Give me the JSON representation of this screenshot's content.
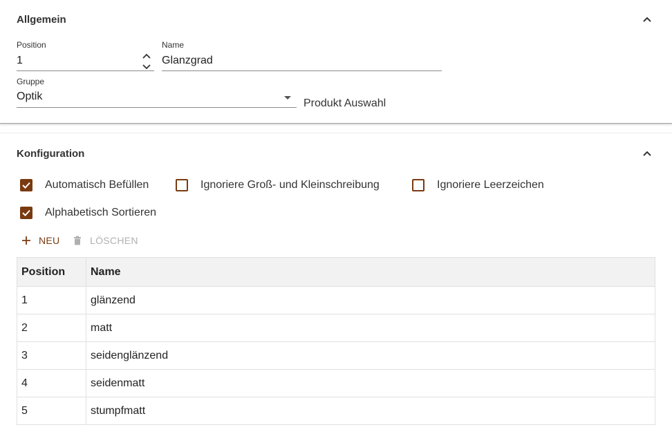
{
  "allgemein": {
    "title": "Allgemein",
    "position_label": "Position",
    "position_value": "1",
    "name_label": "Name",
    "name_value": "Glanzgrad",
    "gruppe_label": "Gruppe",
    "gruppe_value": "Optik",
    "product_label": "Produkt Auswahl"
  },
  "konfiguration": {
    "title": "Konfiguration",
    "checkboxes": [
      {
        "label": "Automatisch Befüllen",
        "checked": true
      },
      {
        "label": "Ignoriere Groß- und Kleinschreibung",
        "checked": false
      },
      {
        "label": "Ignoriere Leerzeichen",
        "checked": false
      },
      {
        "label": "Alphabetisch Sortieren",
        "checked": true
      }
    ],
    "toolbar": {
      "new_label": "NEU",
      "delete_label": "LÖSCHEN"
    },
    "table": {
      "headers": [
        "Position",
        "Name"
      ],
      "rows": [
        [
          "1",
          "glänzend"
        ],
        [
          "2",
          "matt"
        ],
        [
          "3",
          "seidenglänzend"
        ],
        [
          "4",
          "seidenmatt"
        ],
        [
          "5",
          "stumpfmatt"
        ]
      ]
    }
  },
  "colors": {
    "accent": "#7a3a10",
    "disabled": "#b0b0b0"
  }
}
